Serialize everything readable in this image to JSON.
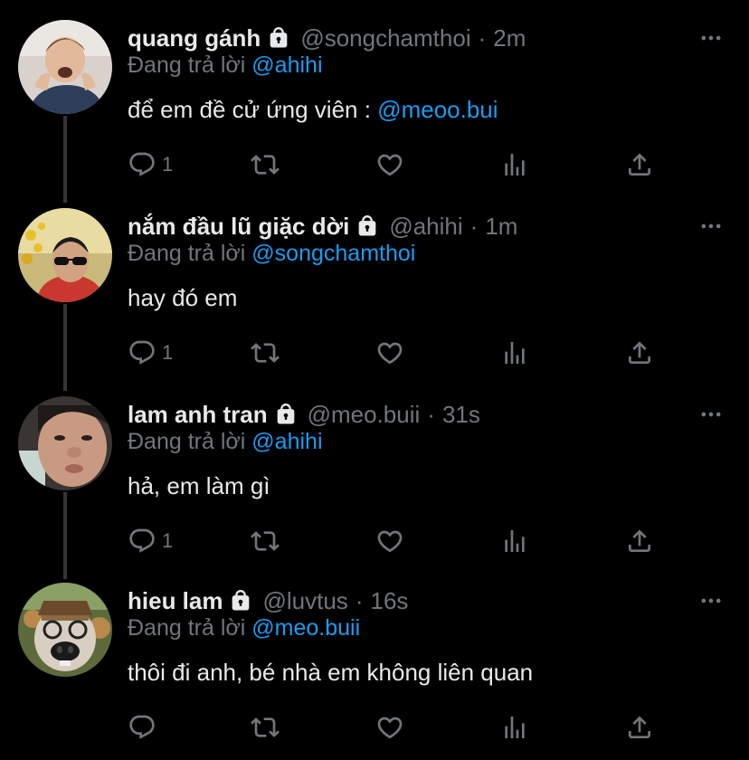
{
  "tweets": [
    {
      "name": "quang gánh",
      "handle": "@songchamthoi",
      "dot": "·",
      "time": "2m",
      "reply_prefix": "Đang trả lời",
      "reply_to": "@ahihi",
      "text_main": "để em đề cử ứng viên : ",
      "text_mention": "@meoo.bui",
      "reply_count": "1"
    },
    {
      "name": "nắm đầu lũ giặc dời",
      "handle": "@ahihi",
      "dot": "·",
      "time": "1m",
      "reply_prefix": "Đang trả lời",
      "reply_to": "@songchamthoi",
      "text_main": "hay đó em",
      "text_mention": "",
      "reply_count": "1"
    },
    {
      "name": "lam anh tran",
      "handle": "@meo.buii",
      "dot": "·",
      "time": "31s",
      "reply_prefix": "Đang trả lời",
      "reply_to": "@ahihi",
      "text_main": "hả, em làm gì",
      "text_mention": "",
      "reply_count": "1"
    },
    {
      "name": "hieu lam",
      "handle": "@luvtus",
      "dot": "·",
      "time": "16s",
      "reply_prefix": "Đang trả lời",
      "reply_to": "@meo.buii",
      "text_main": "thôi đi anh, bé nhà em không liên quan",
      "text_mention": "",
      "reply_count": ""
    }
  ],
  "colors": {
    "background": "#000000",
    "text": "#e7e9ea",
    "muted": "#71767b",
    "link": "#1d9bf0",
    "thread_line": "#333639"
  },
  "icons": [
    "lock-icon",
    "more-icon",
    "reply-icon",
    "retweet-icon",
    "like-icon",
    "analytics-icon",
    "share-icon"
  ]
}
